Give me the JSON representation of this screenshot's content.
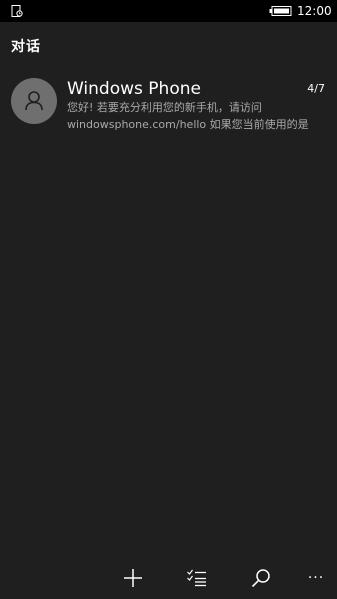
{
  "status_bar": {
    "time": "12:00"
  },
  "header": {
    "title": "对话"
  },
  "conversations": [
    {
      "name": "Windows Phone",
      "date": "4/7",
      "preview_line1": "您好! 若要充分利用您的新手机，请访问",
      "preview_line2": "windowsphone.com/hello  如果您当前使用的是"
    }
  ],
  "app_bar": {
    "new_icon": "plus-icon",
    "select_icon": "select-list-icon",
    "search_icon": "search-icon",
    "more_label": "···"
  },
  "colors": {
    "background": "#1f1f1f",
    "status_bar": "#000000",
    "avatar": "#6f6f6f",
    "secondary_text": "#a9a9a9"
  }
}
